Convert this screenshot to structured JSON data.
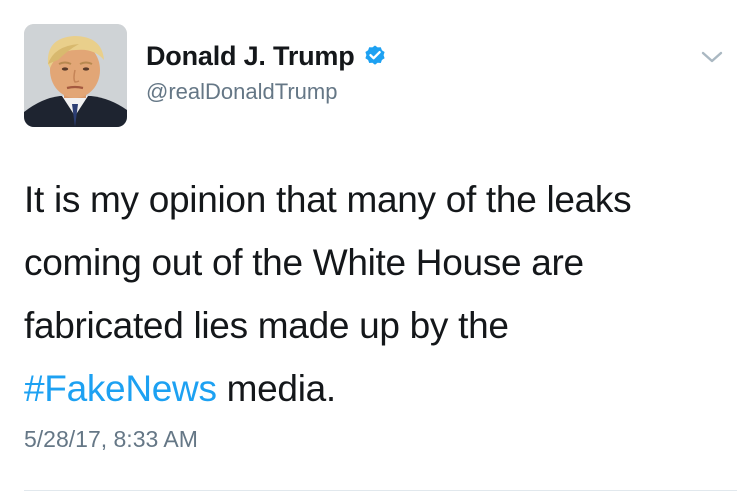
{
  "author": {
    "display_name": "Donald J. Trump",
    "handle": "@realDonaldTrump",
    "verified": true
  },
  "tweet": {
    "text_lines": [
      "It is my opinion that many of the leaks",
      "coming out of the White House are",
      "fabricated lies made up by the"
    ],
    "hashtag": "#FakeNews",
    "after_hashtag": " media.",
    "timestamp": "5/28/17, 8:33 AM"
  },
  "icons": {
    "verified": "verified-badge-icon",
    "menu": "chevron-down-icon"
  },
  "colors": {
    "link": "#1da1f2",
    "secondary_text": "#657786",
    "primary_text": "#14171a",
    "verified_badge": "#1da1f2"
  }
}
